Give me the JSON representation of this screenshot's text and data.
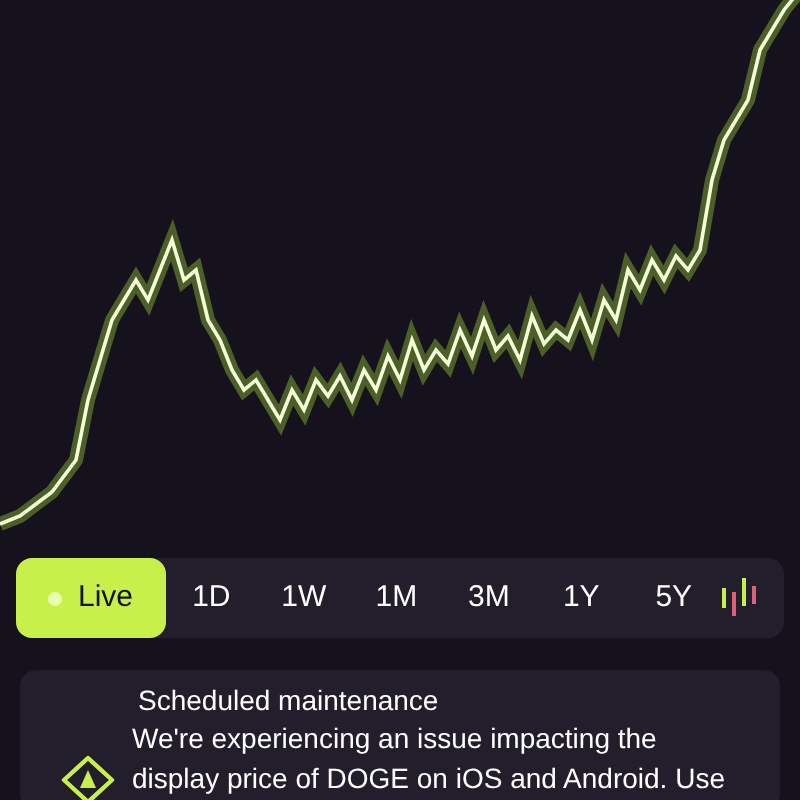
{
  "ranges": [
    {
      "label": "Live",
      "selected": true
    },
    {
      "label": "1D",
      "selected": false
    },
    {
      "label": "1W",
      "selected": false
    },
    {
      "label": "1M",
      "selected": false
    },
    {
      "label": "3M",
      "selected": false
    },
    {
      "label": "1Y",
      "selected": false
    },
    {
      "label": "5Y",
      "selected": false
    }
  ],
  "notice": {
    "title": "Scheduled maintenance",
    "body_lines": [
      "We're experiencing an issue impacting the",
      "display price of DOGE on iOS and Android. Use"
    ]
  }
}
